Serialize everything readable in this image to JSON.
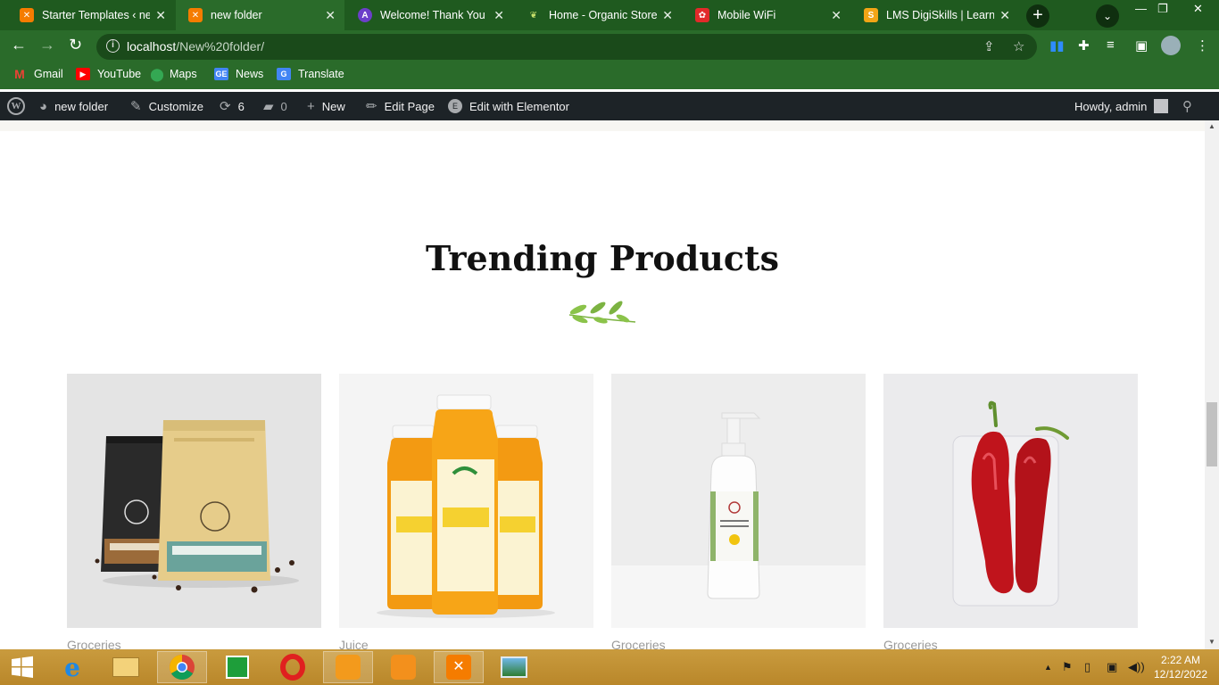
{
  "browser": {
    "tabs": [
      {
        "title": "Starter Templates ‹ new",
        "favicon": "xampp-icon",
        "active": false
      },
      {
        "title": "new folder",
        "favicon": "xampp-icon",
        "active": true
      },
      {
        "title": "Welcome! Thank You fo",
        "favicon": "astra-icon",
        "active": false
      },
      {
        "title": "Home - Organic Store",
        "favicon": "organic-leaf-icon",
        "active": false
      },
      {
        "title": "Mobile WiFi",
        "favicon": "huawei-icon",
        "active": false
      },
      {
        "title": "LMS DigiSkills | Learnin",
        "favicon": "digiskills-icon",
        "active": false
      }
    ],
    "address": {
      "host": "localhost",
      "path": "/New%20folder/"
    },
    "bookmarks": [
      "Gmail",
      "YouTube",
      "Maps",
      "News",
      "Translate"
    ]
  },
  "wp_admin_bar": {
    "site_name": "new folder",
    "customize": "Customize",
    "updates_count": "6",
    "comments_count": "0",
    "new_label": "New",
    "edit_page": "Edit Page",
    "edit_elementor": "Edit with Elementor",
    "howdy": "Howdy, admin"
  },
  "section": {
    "title": "Trending Products",
    "products": [
      {
        "category": "Groceries",
        "image": "coffee-bags"
      },
      {
        "category": "Juice",
        "image": "orange-juice-bottles"
      },
      {
        "category": "Groceries",
        "image": "hand-sanitizer"
      },
      {
        "category": "Groceries",
        "image": "red-chili-peppers"
      }
    ]
  },
  "taskbar": {
    "time": "2:22 AM",
    "date": "12/12/2022"
  },
  "colors": {
    "tab_strip": "#1f5a1f",
    "toolbar": "#2a6b2a",
    "wp_bar": "#1d2327",
    "accent_leaf": "#7cb342",
    "taskbar": "#c99b3e"
  }
}
